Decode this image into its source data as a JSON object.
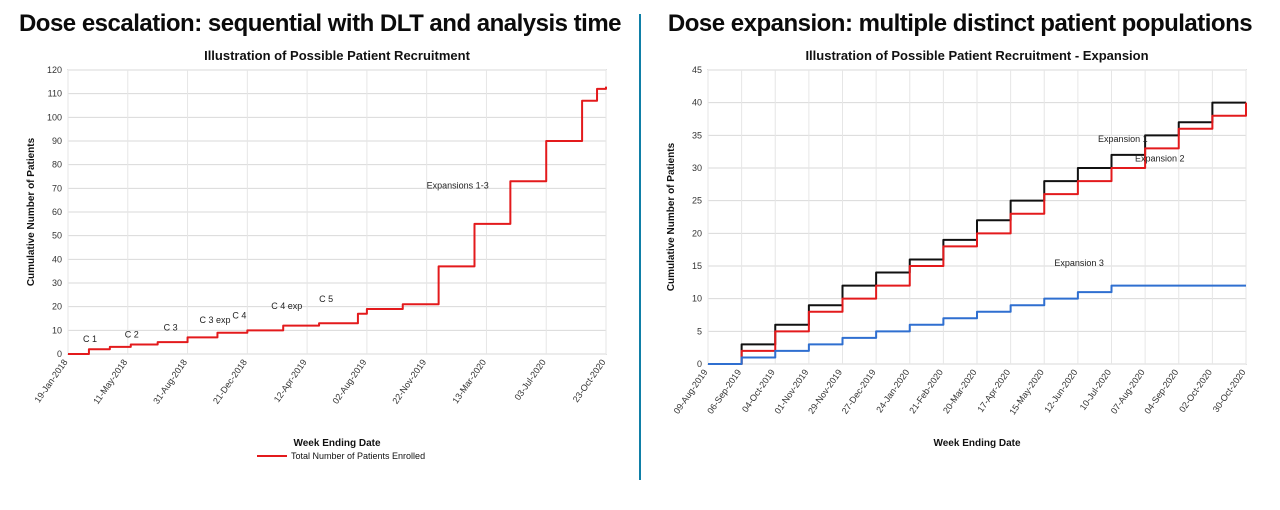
{
  "left": {
    "heading": "Dose escalation: sequential with DLT and analysis time"
  },
  "right": {
    "heading": "Dose expansion: multiple distinct patient populations"
  },
  "chart_data": [
    {
      "id": "escalation",
      "type": "line",
      "title": "Illustration of Possible Patient Recruitment",
      "xlabel": "Week Ending Date",
      "ylabel": "Cumulative Number of Patients",
      "legend": "Total Number of Patients Enrolled",
      "ylim": [
        0,
        120
      ],
      "yticks": [
        0,
        10,
        20,
        30,
        40,
        50,
        60,
        70,
        80,
        90,
        100,
        110,
        120
      ],
      "xticks": [
        "19-Jan-2018",
        "11-May-2018",
        "31-Aug-2018",
        "21-Dec-2018",
        "12-Apr-2019",
        "02-Aug-2019",
        "22-Nov-2019",
        "13-Mar-2020",
        "03-Jul-2020",
        "23-Oct-2020"
      ],
      "series": [
        {
          "name": "Total Number of Patients Enrolled",
          "color": "#e31a1c",
          "xi": [
            0,
            0.35,
            0.7,
            1.05,
            1.5,
            2.0,
            2.5,
            3.0,
            3.6,
            4.2,
            4.85,
            5.0,
            5.6,
            6.2,
            6.8,
            7.4,
            8.0,
            8.6,
            8.85,
            9.0
          ],
          "y": [
            0,
            2,
            3,
            4,
            5,
            7,
            9,
            10,
            12,
            13,
            17,
            19,
            21,
            37,
            55,
            73,
            90,
            107,
            112,
            113
          ]
        }
      ],
      "annotations": [
        {
          "text": "C 1",
          "xi": 0.25,
          "y": 5
        },
        {
          "text": "C 2",
          "xi": 0.95,
          "y": 7
        },
        {
          "text": "C 3",
          "xi": 1.6,
          "y": 10
        },
        {
          "text": "C 3 exp",
          "xi": 2.2,
          "y": 13
        },
        {
          "text": "C 4",
          "xi": 2.75,
          "y": 15
        },
        {
          "text": "C 4 exp",
          "xi": 3.4,
          "y": 19
        },
        {
          "text": "C 5",
          "xi": 4.2,
          "y": 22
        },
        {
          "text": "Expansions 1-3",
          "xi": 6.0,
          "y": 70
        }
      ]
    },
    {
      "id": "expansion",
      "type": "line",
      "title": "Illustration of Possible Patient Recruitment - Expansion",
      "xlabel": "Week Ending Date",
      "ylabel": "Cumulative Number of Patients",
      "ylim": [
        0,
        45
      ],
      "yticks": [
        0,
        5,
        10,
        15,
        20,
        25,
        30,
        35,
        40,
        45
      ],
      "xticks": [
        "09-Aug-2019",
        "06-Sep-2019",
        "04-Oct-2019",
        "01-Nov-2019",
        "29-Nov-2019",
        "27-Dec-2019",
        "24-Jan-2020",
        "21-Feb-2020",
        "20-Mar-2020",
        "17-Apr-2020",
        "15-May-2020",
        "12-Jun-2020",
        "10-Jul-2020",
        "07-Aug-2020",
        "04-Sep-2020",
        "02-Oct-2020",
        "30-Oct-2020"
      ],
      "series": [
        {
          "name": "Expansion 1",
          "color": "#111111",
          "xi": [
            0,
            1,
            2,
            3,
            4,
            5,
            6,
            7,
            8,
            9,
            10,
            11,
            12,
            13,
            14,
            15,
            16
          ],
          "y": [
            0,
            3,
            6,
            9,
            12,
            14,
            16,
            19,
            22,
            25,
            28,
            30,
            32,
            35,
            37,
            40,
            40
          ]
        },
        {
          "name": "Expansion 2",
          "color": "#e31a1c",
          "xi": [
            0,
            1,
            2,
            3,
            4,
            5,
            6,
            7,
            8,
            9,
            10,
            11,
            12,
            13,
            14,
            15,
            16
          ],
          "y": [
            0,
            2,
            5,
            8,
            10,
            12,
            15,
            18,
            20,
            23,
            26,
            28,
            30,
            33,
            36,
            38,
            40
          ]
        },
        {
          "name": "Expansion 3",
          "color": "#2f6fd0",
          "xi": [
            0,
            1,
            2,
            3,
            4,
            5,
            6,
            7,
            8,
            9,
            10,
            11,
            12,
            13,
            14,
            15,
            16
          ],
          "y": [
            0,
            1,
            2,
            3,
            4,
            5,
            6,
            7,
            8,
            9,
            10,
            11,
            12,
            12,
            12,
            12,
            12
          ]
        }
      ],
      "annotations": [
        {
          "text": "Expansion 1",
          "xi": 11.6,
          "y": 34
        },
        {
          "text": "Expansion 2",
          "xi": 12.7,
          "y": 31
        },
        {
          "text": "Expansion 3",
          "xi": 10.3,
          "y": 15
        }
      ]
    }
  ]
}
